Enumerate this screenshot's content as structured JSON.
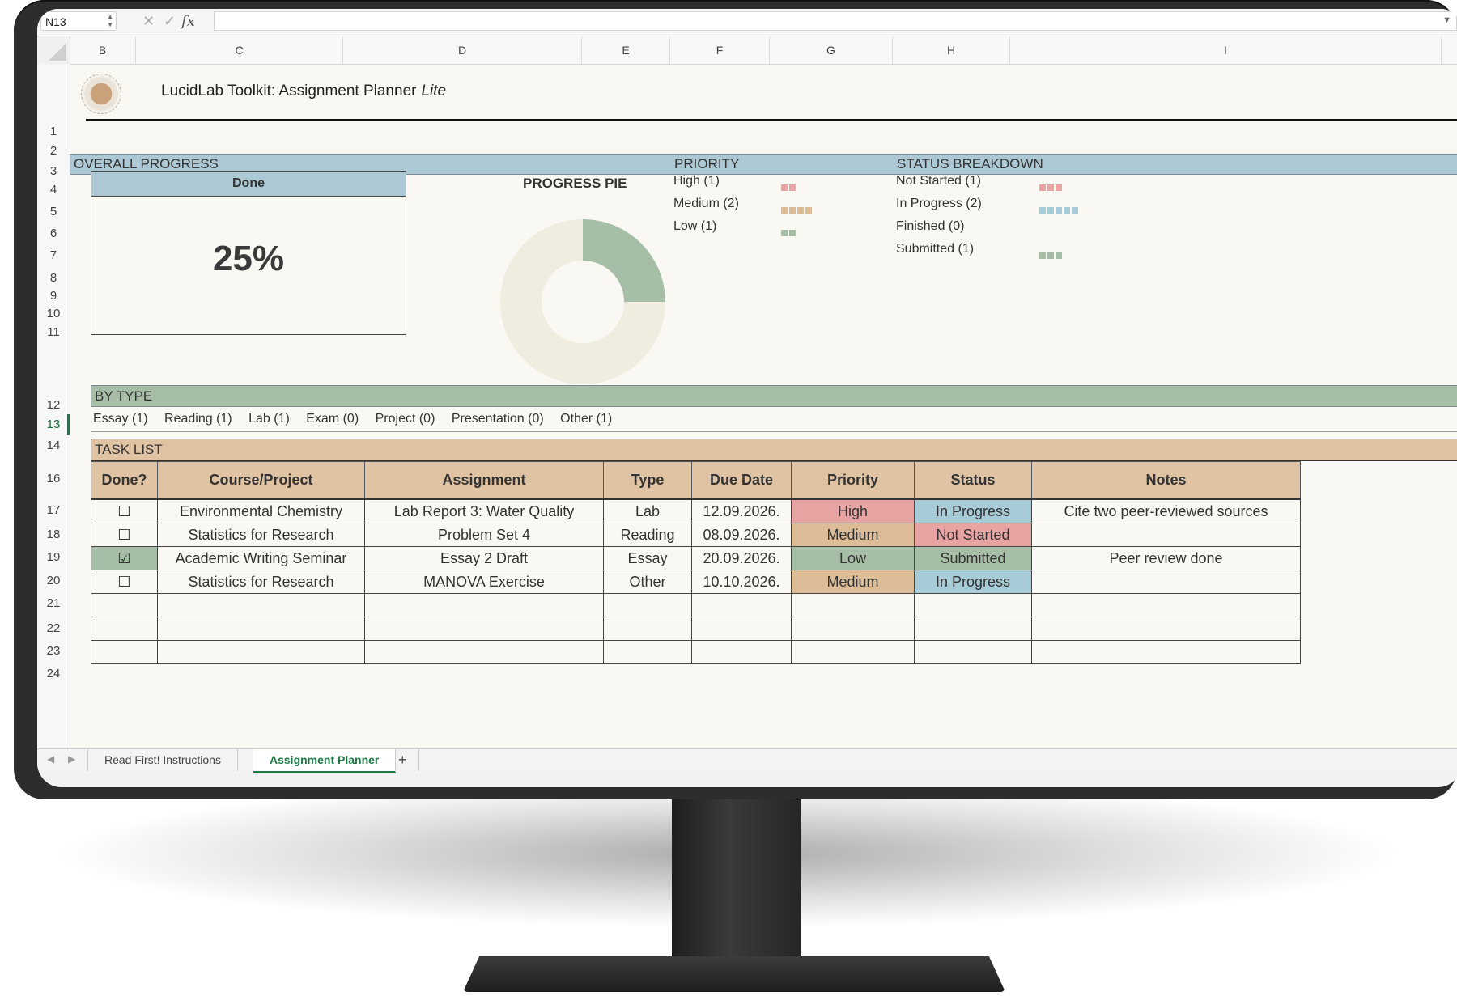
{
  "formula_bar": {
    "name_box": "N13",
    "cancel_icon": "✕",
    "enter_icon": "✓",
    "fx_label": "fx",
    "formula": ""
  },
  "columns": [
    "B",
    "C",
    "D",
    "E",
    "F",
    "G",
    "H",
    "I"
  ],
  "rows": [
    "1",
    "2",
    "3",
    "4",
    "5",
    "6",
    "7",
    "8",
    "9",
    "10",
    "11",
    "12",
    "13",
    "14",
    "16",
    "17",
    "18",
    "19",
    "20",
    "21",
    "22",
    "23",
    "24"
  ],
  "header": {
    "title": "LucidLab Toolkit: Assignment Planner",
    "title_suffix": "Lite"
  },
  "sections": {
    "overall": "OVERALL PROGRESS",
    "priority": "PRIORITY",
    "status": "STATUS BREAKDOWN",
    "by_type": "BY TYPE",
    "task_list": "TASK LIST"
  },
  "progress": {
    "label": "Done",
    "value": "25%",
    "fraction": 0.25,
    "pie_title": "PROGRESS PIE"
  },
  "colors": {
    "section_blue": "#acc8d4",
    "section_green": "#a6bea5",
    "section_tan": "#dfc3a3",
    "high": "#e8a3a3",
    "medium": "#dcbd97",
    "low": "#a6bea5",
    "in_progress": "#a8cbd8",
    "pie_done": "#a6bea5",
    "pie_rest": "#f1ece0"
  },
  "priority_legend": [
    {
      "label": "High (1)",
      "count": 2,
      "color": "#e8a3a3"
    },
    {
      "label": "Medium (2)",
      "count": 4,
      "color": "#dcbd97"
    },
    {
      "label": "Low (1)",
      "count": 2,
      "color": "#a6bea5"
    }
  ],
  "status_legend": [
    {
      "label": "Not Started (1)",
      "count": 3,
      "color": "#e8a3a3"
    },
    {
      "label": "In Progress (2)",
      "count": 5,
      "color": "#a8cbd8"
    },
    {
      "label": "Finished (0)",
      "count": 0,
      "color": "#a6bea5"
    },
    {
      "label": "Submitted (1)",
      "count": 3,
      "color": "#a6bea5"
    }
  ],
  "types": [
    "Essay (1)",
    "Reading (1)",
    "Lab (1)",
    "Exam (0)",
    "Project (0)",
    "Presentation (0)",
    "Other (1)"
  ],
  "task_headers": [
    "Done?",
    "Course/Project",
    "Assignment",
    "Type",
    "Due Date",
    "Priority",
    "Status",
    "Notes"
  ],
  "tasks": [
    {
      "done": "☐",
      "course": "Environmental Chemistry",
      "assignment": "Lab Report 3: Water Quality",
      "type": "Lab",
      "due": "12.09.2026.",
      "priority": "High",
      "status": "In Progress",
      "notes": "Cite two peer-reviewed sources"
    },
    {
      "done": "☐",
      "course": "Statistics for Research",
      "assignment": "Problem Set 4",
      "type": "Reading",
      "due": "08.09.2026.",
      "priority": "Medium",
      "status": "Not Started",
      "notes": ""
    },
    {
      "done": "☑",
      "course": "Academic Writing Seminar",
      "assignment": "Essay 2 Draft",
      "type": "Essay",
      "due": "20.09.2026.",
      "priority": "Low",
      "status": "Submitted",
      "notes": "Peer review done"
    },
    {
      "done": "☐",
      "course": "Statistics for Research",
      "assignment": "MANOVA Exercise",
      "type": "Other",
      "due": "10.10.2026.",
      "priority": "Medium",
      "status": "In Progress",
      "notes": ""
    }
  ],
  "sheet_tabs": {
    "tab1": "Read First! Instructions",
    "tab2": "Assignment Planner",
    "add": "+",
    "prev": "◀",
    "next": "▶"
  }
}
